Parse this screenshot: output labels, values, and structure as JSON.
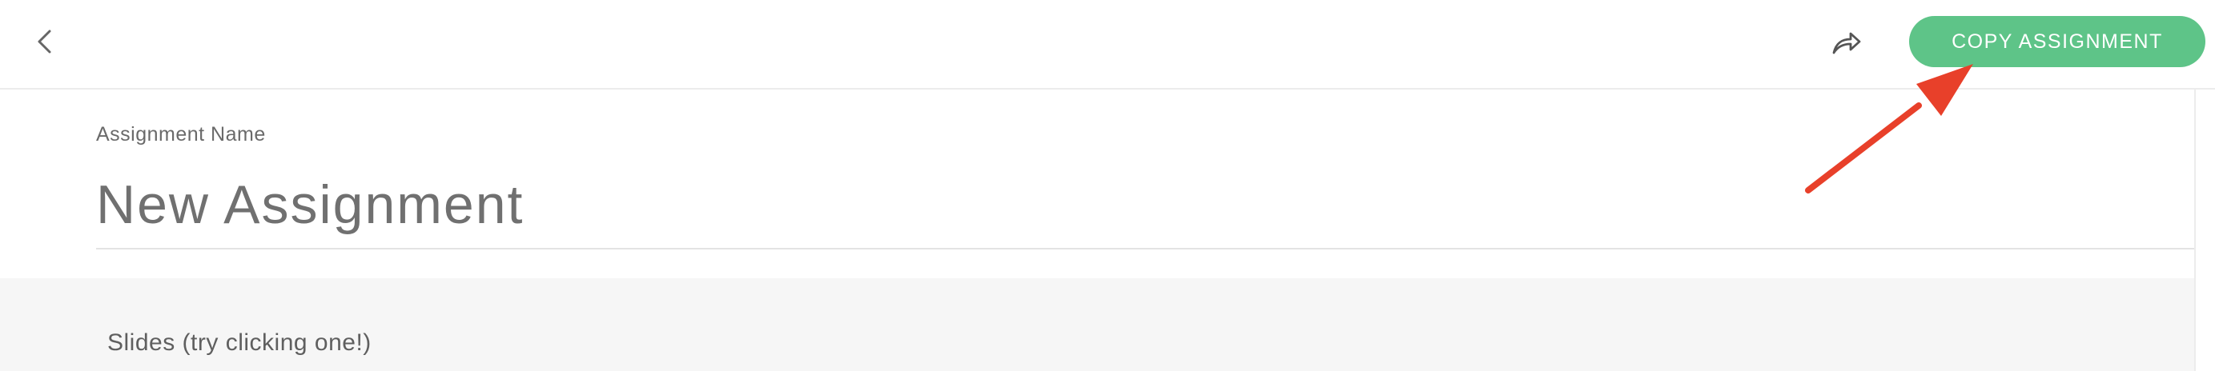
{
  "header": {
    "back_icon": "chevron-left-icon",
    "share_icon": "share-forward-icon",
    "copy_button_label": "COPY ASSIGNMENT",
    "copy_button_color": "#5ec488"
  },
  "assignment": {
    "name_label": "Assignment Name",
    "name_value": "New Assignment"
  },
  "slides": {
    "heading": "Slides (try clicking one!)"
  },
  "annotation": {
    "arrow_color": "#e8402a"
  }
}
